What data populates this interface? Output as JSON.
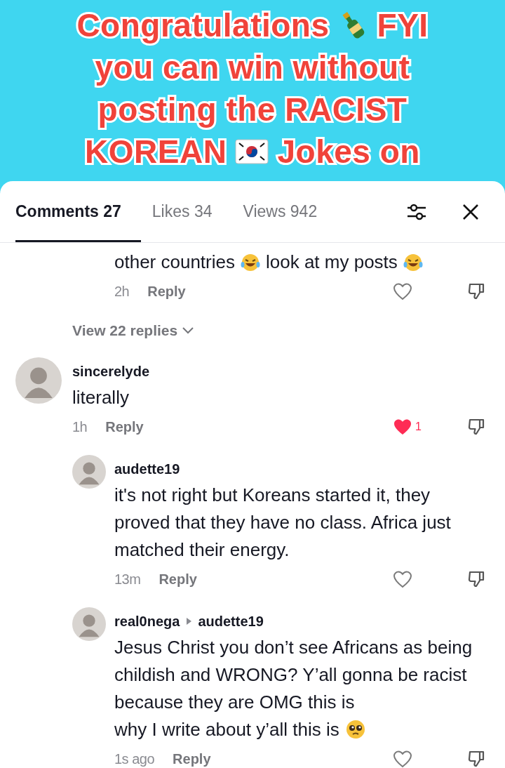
{
  "caption": {
    "lines": [
      [
        {
          "kind": "text",
          "text": "Congratulations"
        },
        {
          "kind": "bottle"
        },
        {
          "kind": "text",
          "text": "FYI"
        }
      ],
      [
        {
          "kind": "text",
          "text": "you can win without"
        }
      ],
      [
        {
          "kind": "text",
          "text": "posting the RACIST"
        }
      ],
      [
        {
          "kind": "text",
          "text": "KOREAN"
        },
        {
          "kind": "flag"
        },
        {
          "kind": "text",
          "text": "Jokes on"
        }
      ]
    ]
  },
  "tabs": [
    {
      "label": "Comments 27",
      "selected": true
    },
    {
      "label": "Likes 34",
      "selected": false
    },
    {
      "label": "Views 942",
      "selected": false
    }
  ],
  "comments": [
    {
      "kind": "reply",
      "parts": [
        {
          "kind": "text",
          "text": "other countries"
        },
        {
          "kind": "laugh"
        },
        {
          "kind": "text",
          "text": "look at my posts"
        },
        {
          "kind": "laugh"
        }
      ],
      "time": "2h",
      "reply_label": "Reply",
      "liked": false
    },
    {
      "kind": "more",
      "text": "View 22 replies"
    },
    {
      "kind": "top",
      "user": "sincerelyde",
      "parts": [
        {
          "kind": "text",
          "text": "literally"
        }
      ],
      "time": "1h",
      "reply_label": "Reply",
      "liked": true,
      "like_count": "1"
    },
    {
      "kind": "reply",
      "user": "audette19",
      "parts": [
        {
          "kind": "text",
          "text": "it's not right but Koreans started it, they proved that they have no class. Africa just matched their energy."
        }
      ],
      "time": "13m",
      "reply_label": "Reply",
      "liked": false
    },
    {
      "kind": "reply",
      "user": "real0nega",
      "reply_to": "audette19",
      "parts": [
        {
          "kind": "text",
          "text": "Jesus Christ you don’t see Africans as being childish and WRONG? Y’all gonna be racist because they are OMG this is"
        },
        {
          "kind": "text",
          "text": "why I write about y’all this is"
        },
        {
          "kind": "pleading"
        }
      ],
      "time": "1s ago",
      "reply_label": "Reply",
      "liked": false
    }
  ]
}
